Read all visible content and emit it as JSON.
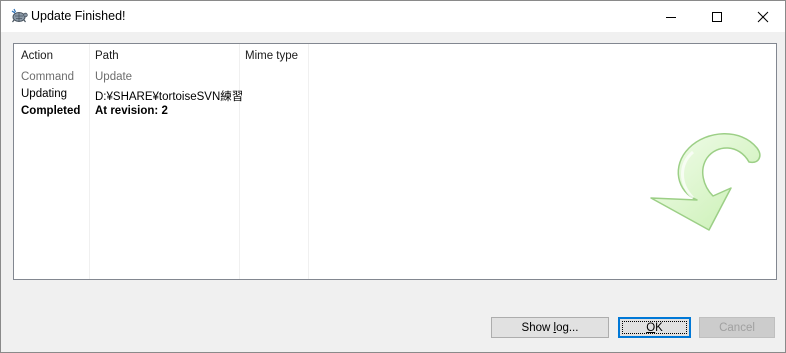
{
  "window": {
    "title": "Update Finished!"
  },
  "list": {
    "columns": [
      "Action",
      "Path",
      "Mime type"
    ],
    "rows": [
      {
        "action": "Command",
        "path": "Update"
      },
      {
        "action": "Updating",
        "path": "D:¥SHARE¥tortoiseSVN練習"
      },
      {
        "action": "Completed",
        "path": "At revision: 2"
      }
    ]
  },
  "buttons": {
    "show_log_pre": "Show ",
    "show_log_mnemonic": "l",
    "show_log_post": "og...",
    "ok_mnemonic": "O",
    "ok_post": "K",
    "cancel": "Cancel"
  },
  "colors": {
    "arrow_fill": "#d9f7c7",
    "arrow_stroke": "#9ccf86",
    "ok_focus_border": "#0078d7"
  },
  "icons": {
    "app": "tortoise-icon",
    "status": "update-arrow-icon"
  }
}
